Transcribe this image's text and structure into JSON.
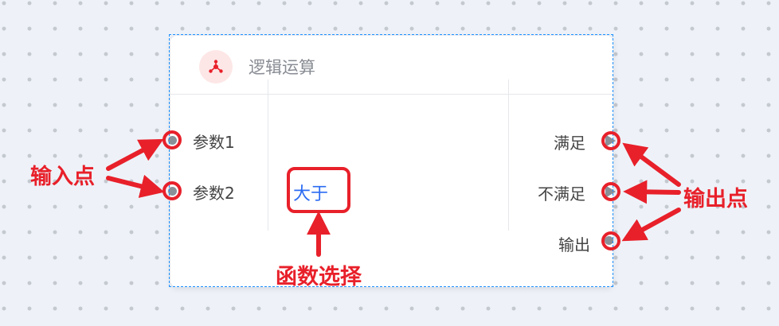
{
  "node": {
    "title": "逻辑运算",
    "icon": "network-node-icon",
    "accent_color": "#e8202a",
    "inputs": [
      {
        "label": "参数1"
      },
      {
        "label": "参数2"
      }
    ],
    "function": "大于",
    "outputs": [
      {
        "label": "满足",
        "shape": "triangle"
      },
      {
        "label": "不满足",
        "shape": "triangle"
      },
      {
        "label": "输出",
        "shape": "dot"
      }
    ]
  },
  "annotations": {
    "input_points": "输入点",
    "output_points": "输出点",
    "function_select": "函数选择",
    "color": "#e8202a"
  }
}
